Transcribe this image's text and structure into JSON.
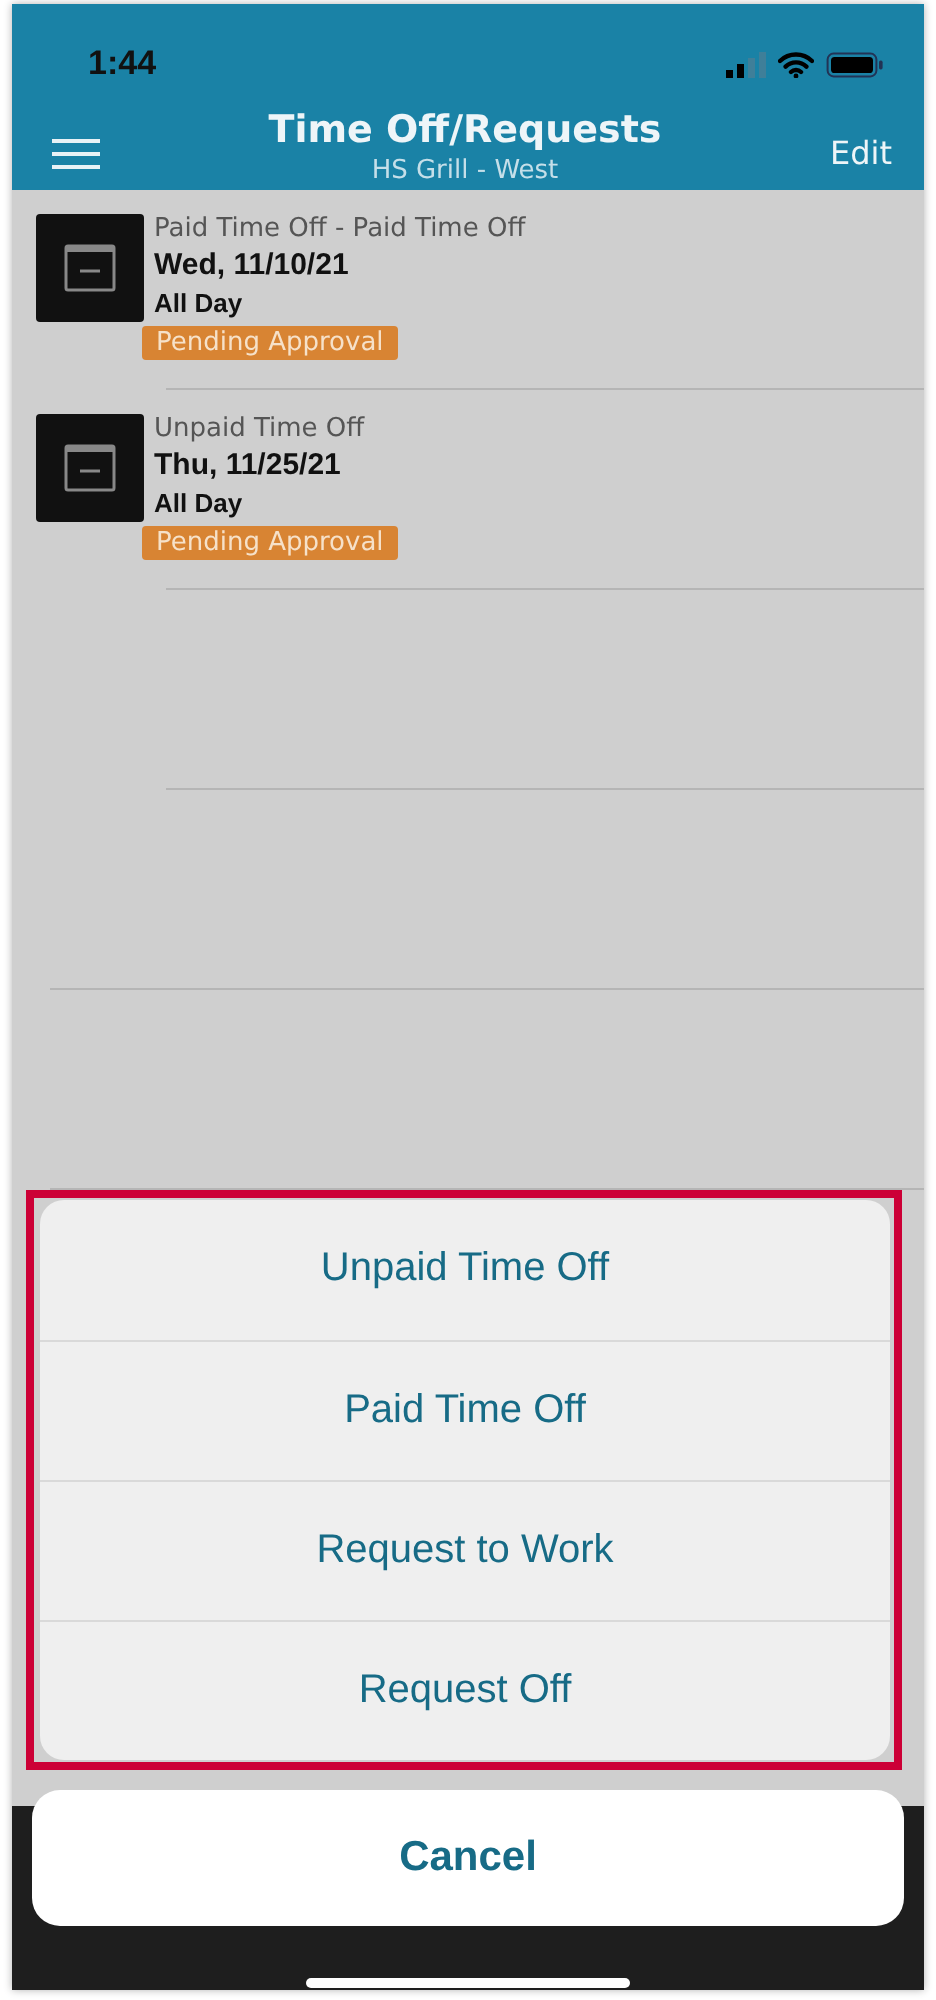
{
  "status_bar": {
    "time": "1:44"
  },
  "header": {
    "title": "Time Off/Requests",
    "subtitle": "HS Grill - West",
    "action": "Edit"
  },
  "requests": [
    {
      "type": "Paid Time Off - Paid Time Off",
      "date": "Wed, 11/10/21",
      "duration": "All Day",
      "status": "Pending Approval"
    },
    {
      "type": "Unpaid Time Off",
      "date": "Thu, 11/25/21",
      "duration": "All Day",
      "status": "Pending Approval"
    }
  ],
  "action_sheet": {
    "options": [
      "Unpaid Time Off",
      "Paid Time Off",
      "Request to Work",
      "Request Off"
    ],
    "cancel": "Cancel"
  }
}
